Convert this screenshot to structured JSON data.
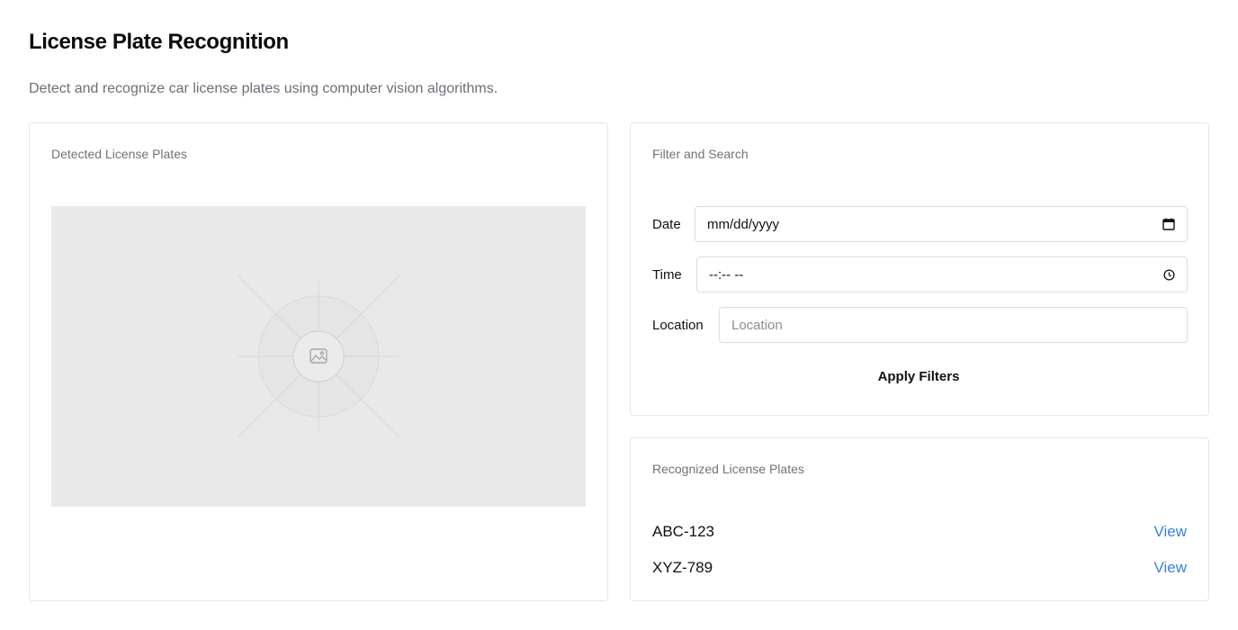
{
  "header": {
    "title": "License Plate Recognition",
    "subtitle": "Detect and recognize car license plates using computer vision algorithms."
  },
  "detected": {
    "title": "Detected License Plates",
    "image_icon": "image-icon"
  },
  "filter": {
    "title": "Filter and Search",
    "date": {
      "label": "Date",
      "value": "mm/dd/yyyy",
      "icon": "calendar-icon"
    },
    "time": {
      "label": "Time",
      "value": "--:-- --",
      "icon": "clock-icon"
    },
    "location": {
      "label": "Location",
      "placeholder": "Location"
    },
    "apply_label": "Apply Filters"
  },
  "recognized": {
    "title": "Recognized License Plates",
    "plates": [
      {
        "number": "ABC-123",
        "action": "View"
      },
      {
        "number": "XYZ-789",
        "action": "View"
      }
    ]
  },
  "colors": {
    "link": "#3f7fd6",
    "border": "#e5e6e8",
    "placeholder_bg": "#e9e9e9"
  }
}
